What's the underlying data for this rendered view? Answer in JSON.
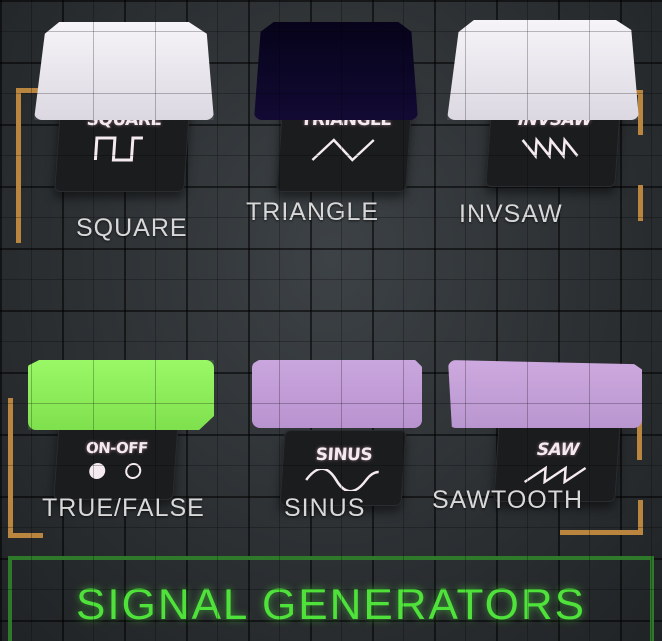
{
  "generators": [
    {
      "id": "square",
      "plate_text": "SQUARE",
      "label": "SQUARE",
      "wave_icon": "square-wave-icon",
      "button_color": "#ece9ef"
    },
    {
      "id": "triangle",
      "plate_text": "TRIANGLE",
      "label": "TRIANGLE",
      "wave_icon": "triangle-wave-icon",
      "button_color": "#0a0622"
    },
    {
      "id": "invsaw",
      "plate_text": "INVSAW",
      "label": "INVSAW",
      "wave_icon": "invsaw-wave-icon",
      "button_color": "#ece9ef"
    },
    {
      "id": "onoff",
      "plate_text": "ON-OFF",
      "label": "TRUE/FALSE",
      "wave_icon": "on-off-icon",
      "button_color": "#8ff05a"
    },
    {
      "id": "sinus",
      "plate_text": "SINUS",
      "label": "SINUS",
      "wave_icon": "sine-wave-icon",
      "button_color": "#c4a0d8"
    },
    {
      "id": "saw",
      "plate_text": "SAW",
      "label": "SAWTOOTH",
      "wave_icon": "saw-wave-icon",
      "button_color": "#c7a3da"
    }
  ],
  "banner": {
    "title": "SIGNAL GENERATORS",
    "color": "#4fe23a"
  },
  "frame_accent": "#b9853f"
}
